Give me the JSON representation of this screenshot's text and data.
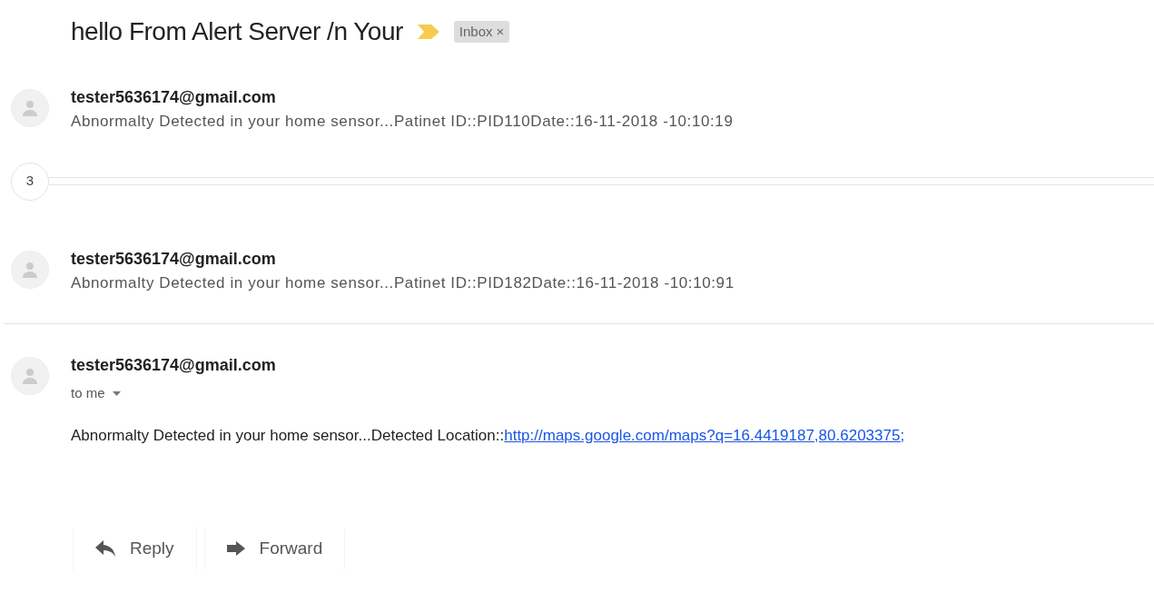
{
  "subject": "hello From Alert Server /n Your",
  "label": {
    "text": "Inbox",
    "remove": "×"
  },
  "messages": [
    {
      "kind": "collapsed",
      "sender": "tester5636174@gmail.com",
      "snippet": "Abnormalty Detected in your home sensor...Patinet ID::PID110Date::16-11-2018 -10:10:19"
    },
    {
      "kind": "hidden_count",
      "count": "3"
    },
    {
      "kind": "collapsed",
      "sender": "tester5636174@gmail.com",
      "snippet": "Abnormalty Detected in your home sensor...Patinet ID::PID182Date::16-11-2018 -10:10:91"
    },
    {
      "kind": "expanded",
      "sender": "tester5636174@gmail.com",
      "recipient": "to me",
      "body": "Abnormalty Detected in your home sensor...Detected Location::",
      "link": "http://maps.google.com/maps?q=16.4419187,80.6203375;"
    }
  ],
  "actions": [
    {
      "kind": "reply",
      "label": "Reply"
    },
    {
      "kind": "forward",
      "label": "Forward"
    }
  ]
}
